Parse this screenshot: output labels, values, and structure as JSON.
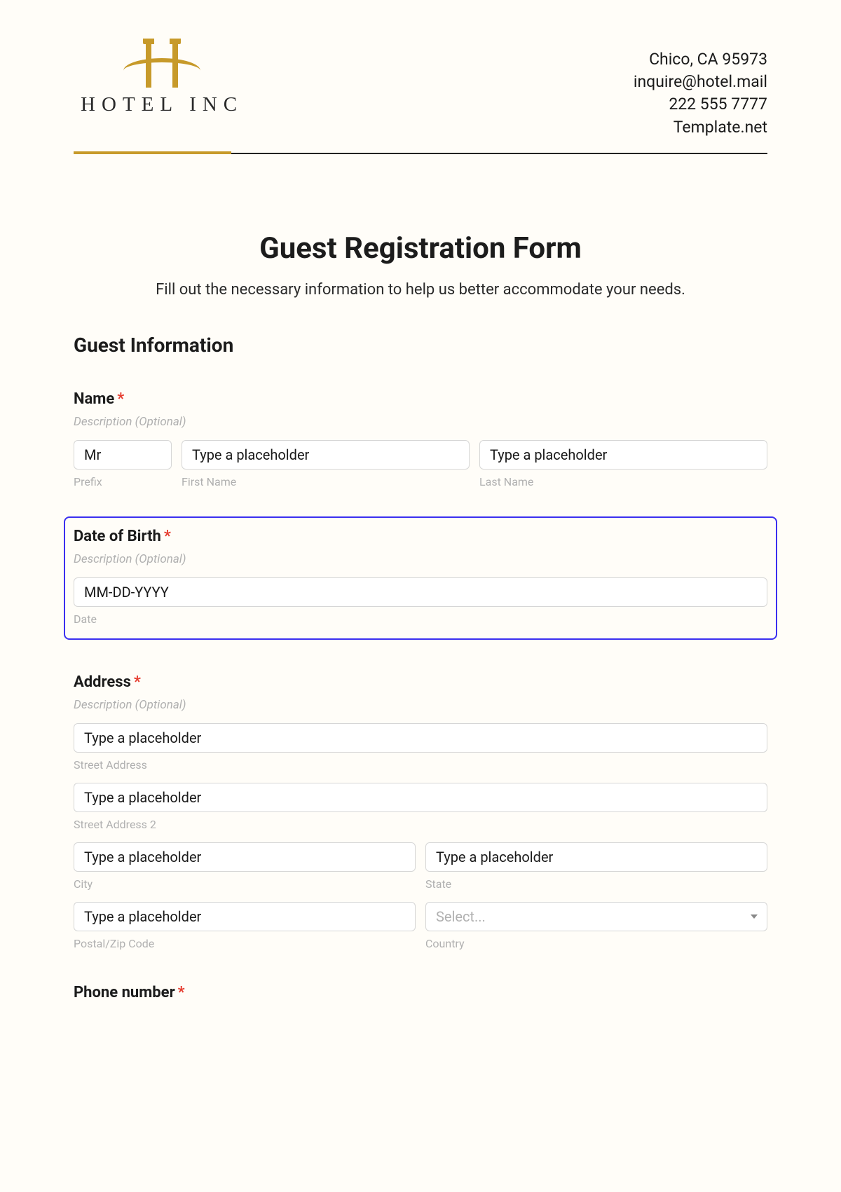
{
  "header": {
    "brand_name": "HOTEL INC",
    "contact": {
      "address": "Chico, CA 95973",
      "email": "inquire@hotel.mail",
      "phone": "222 555 7777",
      "site": "Template.net"
    }
  },
  "form": {
    "title": "Guest Registration Form",
    "subtitle": "Fill out the necessary information to help us better accommodate your needs.",
    "section_guest_info": "Guest Information",
    "description_optional": "Description (Optional)",
    "required_mark": "*",
    "name": {
      "label": "Name",
      "prefix_value": "Mr",
      "prefix_sub": "Prefix",
      "first_placeholder": "Type a placeholder",
      "first_sub": "First Name",
      "last_placeholder": "Type a placeholder",
      "last_sub": "Last Name"
    },
    "dob": {
      "label": "Date of Birth",
      "placeholder": "MM-DD-YYYY",
      "sub": "Date"
    },
    "address": {
      "label": "Address",
      "street_placeholder": "Type a placeholder",
      "street_sub": "Street Address",
      "street2_placeholder": "Type a placeholder",
      "street2_sub": "Street Address 2",
      "city_placeholder": "Type a placeholder",
      "city_sub": "City",
      "state_placeholder": "Type a placeholder",
      "state_sub": "State",
      "zip_placeholder": "Type a placeholder",
      "zip_sub": "Postal/Zip Code",
      "country_placeholder": "Select...",
      "country_sub": "Country"
    },
    "phone": {
      "label": "Phone number"
    }
  }
}
